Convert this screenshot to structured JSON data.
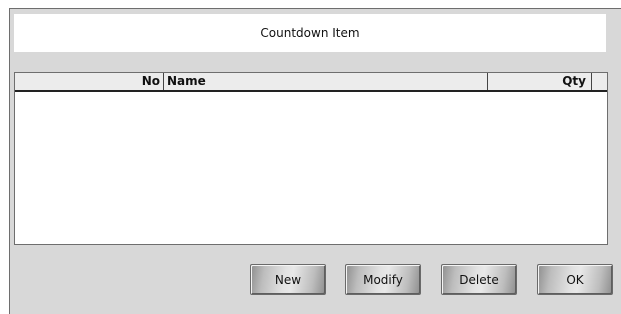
{
  "dialog": {
    "title": "Countdown Item"
  },
  "list": {
    "columns": {
      "no": "No",
      "name": "Name",
      "qty": "Qty"
    },
    "rows": []
  },
  "buttons": {
    "new": "New",
    "modify": "Modify",
    "delete": "Delete",
    "ok": "OK"
  }
}
